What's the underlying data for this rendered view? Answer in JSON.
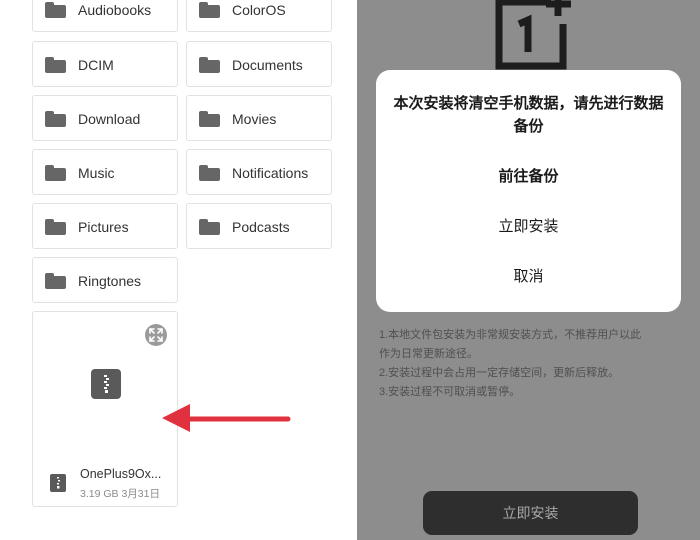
{
  "file_manager": {
    "folders": [
      {
        "label": "Audiobooks",
        "icon": "folder-icon"
      },
      {
        "label": "ColorOS",
        "icon": "folder-icon"
      },
      {
        "label": "DCIM",
        "icon": "folder-icon"
      },
      {
        "label": "Documents",
        "icon": "folder-icon"
      },
      {
        "label": "Download",
        "icon": "folder-icon"
      },
      {
        "label": "Movies",
        "icon": "folder-icon"
      },
      {
        "label": "Music",
        "icon": "folder-icon"
      },
      {
        "label": "Notifications",
        "icon": "folder-icon"
      },
      {
        "label": "Pictures",
        "icon": "folder-icon"
      },
      {
        "label": "Podcasts",
        "icon": "folder-icon"
      },
      {
        "label": "Ringtones",
        "icon": "folder-icon"
      }
    ],
    "file": {
      "name": "OnePlus9Ox...",
      "size": "3.19 GB",
      "date": "3月31日",
      "meta": "3.19 GB 3月31日",
      "icon": "zip-file-icon"
    }
  },
  "installer": {
    "dialog": {
      "title": "本次安装将清空手机数据，请先进行数据备份",
      "options": [
        "前往备份",
        "立即安装",
        "取消"
      ]
    },
    "notes": [
      "1.本地文件包安装为非常规安装方式，不推荐用户以此",
      "作为日常更新途径。",
      "2.安装过程中会占用一定存储空间，更新后释放。",
      "3.安装过程不可取消或暂停。"
    ],
    "install_button": "立即安装"
  },
  "colors": {
    "annotation_arrow": "#e0313f",
    "overlay_background": "#8d8d8d",
    "dialog_background": "#ffffff",
    "install_button_background": "#2e2e2e"
  }
}
